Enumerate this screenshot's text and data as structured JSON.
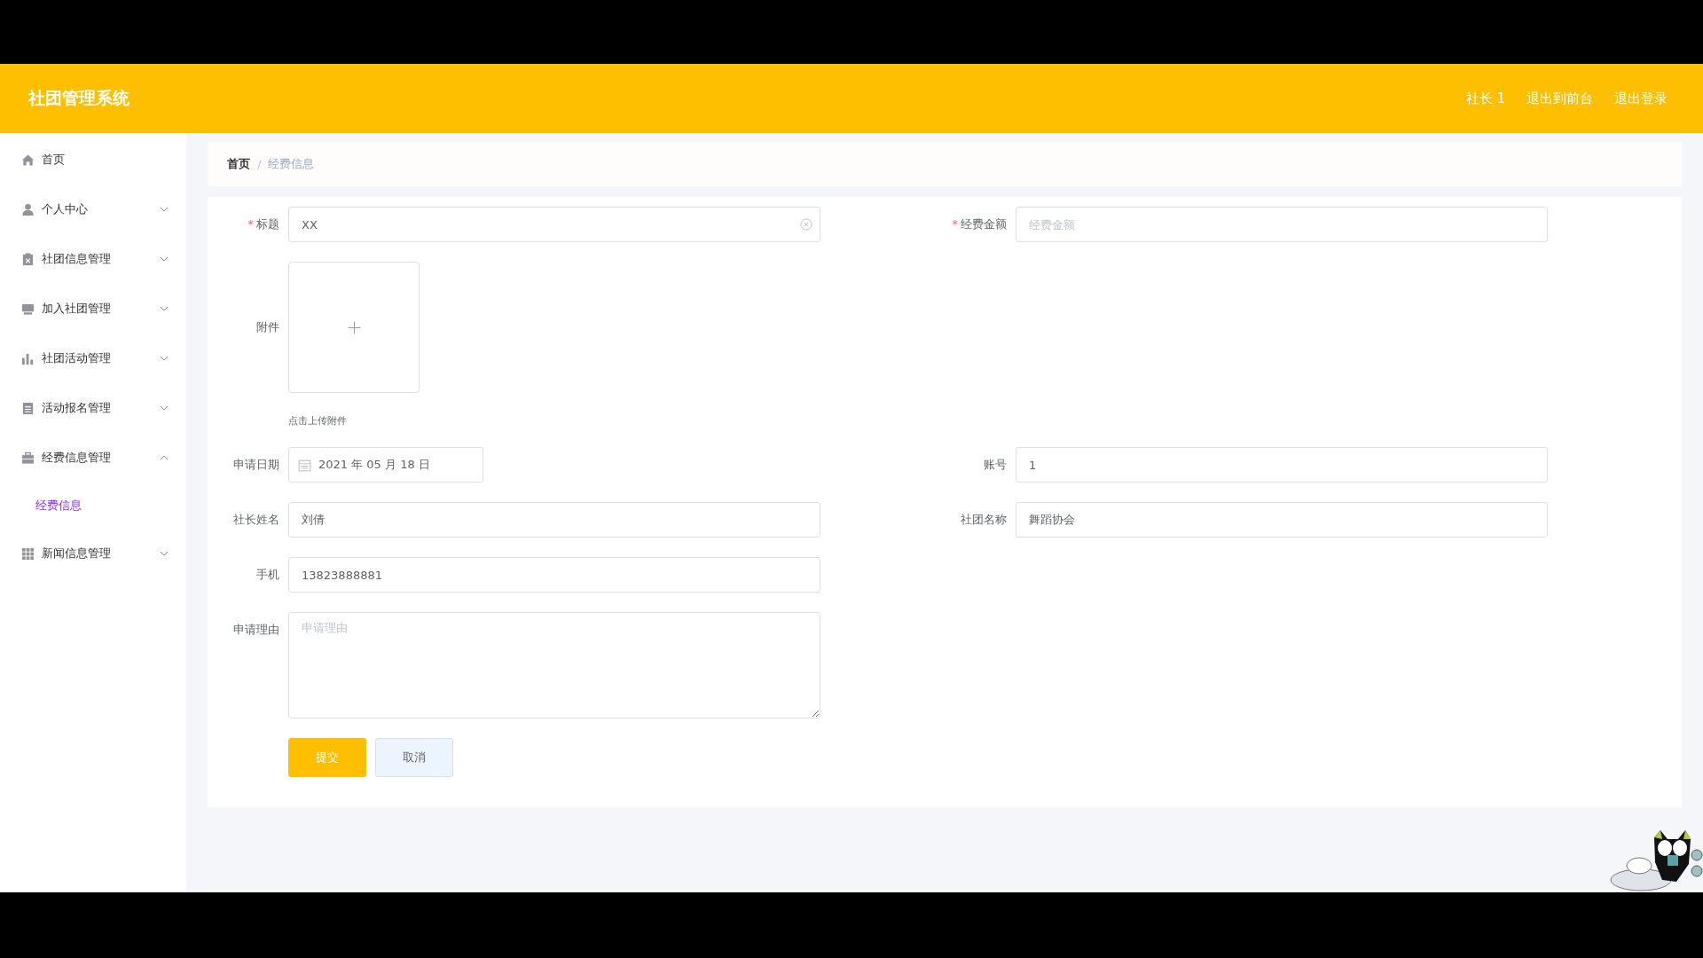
{
  "header": {
    "title": "社团管理系统",
    "links": [
      "社长 1",
      "退出到前台",
      "退出登录"
    ]
  },
  "sidebar": {
    "items": [
      {
        "label": "首页"
      },
      {
        "label": "个人中心",
        "expanded": false
      },
      {
        "label": "社团信息管理",
        "expanded": false
      },
      {
        "label": "加入社团管理",
        "expanded": false
      },
      {
        "label": "社团活动管理",
        "expanded": false
      },
      {
        "label": "活动报名管理",
        "expanded": false
      },
      {
        "label": "经费信息管理",
        "expanded": true,
        "children": [
          {
            "label": "经费信息",
            "selected": true
          }
        ]
      },
      {
        "label": "新闻信息管理",
        "expanded": false
      }
    ]
  },
  "breadcrumb": {
    "separator": "/",
    "items": [
      "首页",
      "经费信息"
    ]
  },
  "form": {
    "rows": [
      [
        {
          "kind": "text",
          "label": "标题",
          "required_mark": "*",
          "value": "XX",
          "clearable": true
        },
        {
          "kind": "text",
          "label": "经费金额",
          "required_mark": "*",
          "placeholder": "经费金额"
        }
      ],
      [
        {
          "kind": "upload",
          "label": "附件",
          "hint": "点击上传附件"
        }
      ],
      [
        {
          "kind": "date",
          "label": "申请日期",
          "value": "2021 年 05 月 18 日"
        },
        {
          "kind": "text",
          "label": "账号",
          "value": "1"
        }
      ],
      [
        {
          "kind": "text",
          "label": "社长姓名",
          "value": "刘倩"
        },
        {
          "kind": "text",
          "label": "社团名称",
          "value": "舞蹈协会"
        }
      ],
      [
        {
          "kind": "text",
          "label": "手机",
          "value": "13823888881"
        }
      ],
      [
        {
          "kind": "textarea",
          "label": "申请理由",
          "placeholder": "申请理由"
        }
      ]
    ],
    "buttons": [
      {
        "label": "提交",
        "kind": "primary"
      },
      {
        "label": "取消",
        "kind": "plain"
      }
    ]
  }
}
